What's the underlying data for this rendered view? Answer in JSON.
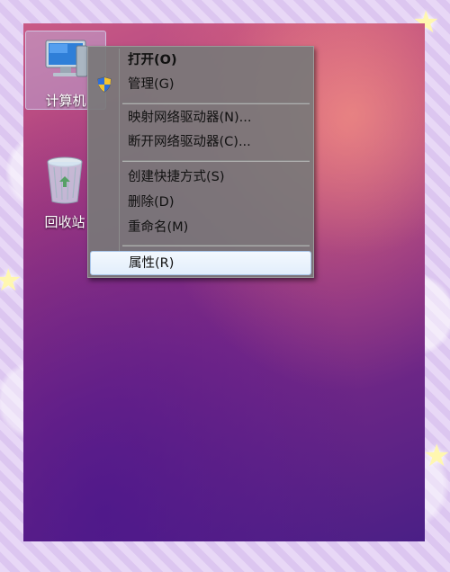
{
  "desktop": {
    "icons": [
      {
        "label": "计算机",
        "icon": "computer-icon"
      },
      {
        "label": "回收站",
        "icon": "recycle-bin-icon"
      }
    ]
  },
  "context_menu": {
    "items": [
      {
        "label": "打开(O)",
        "bold": true
      },
      {
        "label": "管理(G)",
        "icon": "uac-shield-icon"
      },
      {
        "label": "映射网络驱动器(N)..."
      },
      {
        "label": "断开网络驱动器(C)..."
      },
      {
        "label": "创建快捷方式(S)"
      },
      {
        "label": "删除(D)"
      },
      {
        "label": "重命名(M)"
      },
      {
        "label": "属性(R)",
        "highlighted": true
      }
    ]
  }
}
